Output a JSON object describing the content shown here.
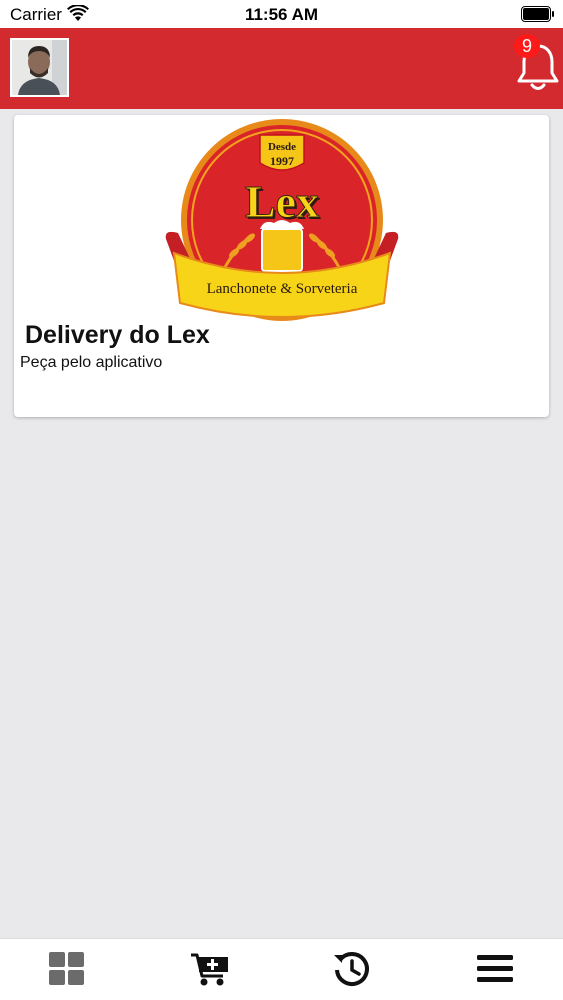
{
  "status_bar": {
    "carrier": "Carrier",
    "time": "11:56 AM"
  },
  "header": {
    "notification_count": "9",
    "avatar_icon": "user-photo",
    "bell_icon": "bell-icon",
    "background_color": "#d32a2f"
  },
  "store": {
    "name": "Delivery do Lex",
    "subtitle": "Peça pelo aplicativo",
    "logo": {
      "top_text": "Desde",
      "year": "1997",
      "brand": "Lex",
      "banner": "Lanchonete & Sorveteria"
    }
  },
  "bottom_nav": {
    "items": [
      {
        "icon": "grid-icon"
      },
      {
        "icon": "cart-plus-icon"
      },
      {
        "icon": "history-icon"
      },
      {
        "icon": "menu-icon"
      }
    ]
  }
}
